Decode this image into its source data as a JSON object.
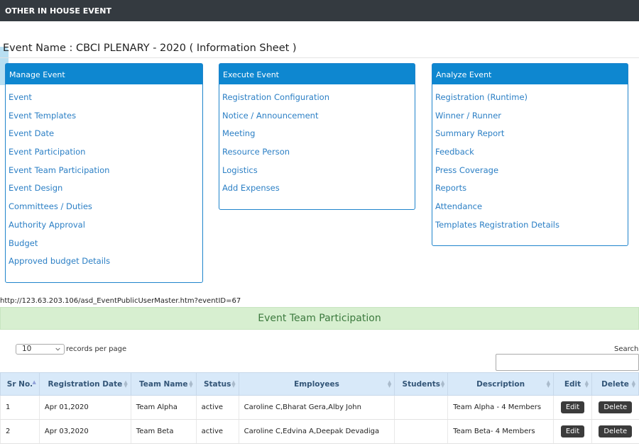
{
  "header": {
    "title": "OTHER IN HOUSE EVENT"
  },
  "event_name": "Event Name : CBCI PLENARY - 2020 ( Information Sheet )",
  "panels": {
    "manage": {
      "title": "Manage Event",
      "items": [
        "Event",
        "Event Templates",
        "Event Date",
        "Event Participation",
        "Event Team Participation",
        "Event Design",
        "Committees / Duties",
        "Authority Approval",
        "Budget",
        "Approved budget Details"
      ]
    },
    "execute": {
      "title": "Execute Event",
      "items": [
        "Registration Configuration",
        "Notice / Announcement",
        "Meeting",
        "Resource Person",
        "Logistics",
        "Add Expenses"
      ]
    },
    "analyze": {
      "title": "Analyze Event",
      "items": [
        "Registration (Runtime)",
        "Winner / Runner",
        "Summary Report",
        "Feedback",
        "Press Coverage",
        "Reports",
        "Attendance",
        "Templates Registration Details"
      ]
    }
  },
  "status_url": "http://123.63.203.106/asd_EventPublicUserMaster.htm?eventID=67",
  "section_title": "Event Team Participation",
  "table_controls": {
    "length_value": "10",
    "length_label": "records per page",
    "search_label": "Search:"
  },
  "table": {
    "headers": [
      "Sr No.",
      "Registration Date",
      "Team Name",
      "Status",
      "Employees",
      "Students",
      "Description",
      "Edit",
      "Delete"
    ],
    "rows": [
      {
        "sr": "1",
        "date": "Apr 01,2020",
        "team": "Team Alpha",
        "status": "active",
        "employees": "Caroline C,Bharat Gera,Alby John",
        "students": "",
        "description": "Team Alpha - 4 Members",
        "edit": "Edit",
        "delete": "Delete"
      },
      {
        "sr": "2",
        "date": "Apr 03,2020",
        "team": "Team Beta",
        "status": "active",
        "employees": "Caroline C,Edvina A,Deepak Devadiga",
        "students": "",
        "description": "Team Beta- 4 Members",
        "edit": "Edit",
        "delete": "Delete"
      }
    ]
  }
}
